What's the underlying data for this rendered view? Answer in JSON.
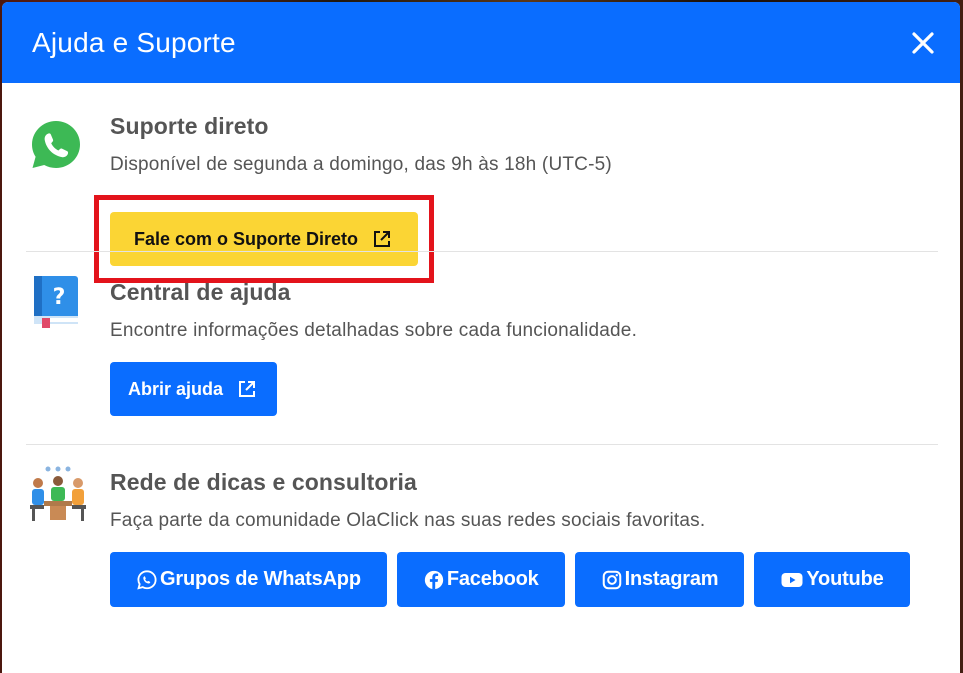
{
  "modal": {
    "title": "Ajuda e Suporte",
    "close_icon": "close-icon"
  },
  "direct_support": {
    "title": "Suporte direto",
    "description": "Disponível de segunda a domingo, das 9h às 18h (UTC-5)",
    "button_label": "Fale com o Suporte Direto",
    "icon": "whatsapp-icon",
    "button_icon": "external-link-icon",
    "highlight_color": "#e3131b"
  },
  "help_center": {
    "title": "Central de ajuda",
    "description": "Encontre informações detalhadas sobre cada funcionalidade.",
    "button_label": "Abrir ajuda",
    "icon": "help-book-icon",
    "button_icon": "external-link-icon"
  },
  "community": {
    "title": "Rede de dicas e consultoria",
    "description": "Faça parte da comunidade OlaClick nas suas redes sociais favoritas.",
    "icon": "team-meeting-icon",
    "buttons": [
      {
        "label": "Grupos de WhatsApp",
        "icon": "whatsapp-icon"
      },
      {
        "label": "Facebook",
        "icon": "facebook-icon"
      },
      {
        "label": "Instagram",
        "icon": "instagram-icon"
      },
      {
        "label": "Youtube",
        "icon": "youtube-icon"
      }
    ]
  },
  "colors": {
    "primary": "#0a6dff",
    "accent_yellow": "#fbd534",
    "text": "#555555"
  }
}
